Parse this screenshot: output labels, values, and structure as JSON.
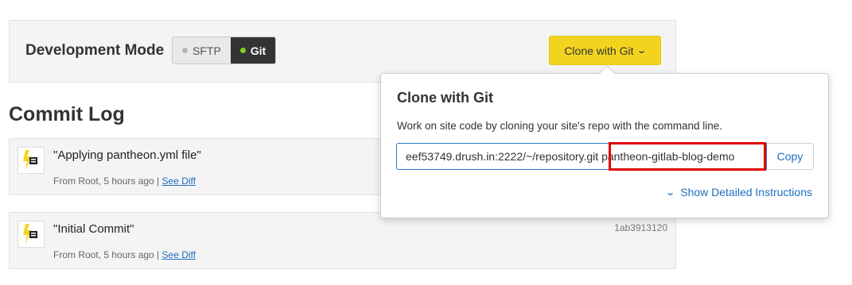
{
  "dev_mode": {
    "title": "Development Mode",
    "options": [
      {
        "label": "SFTP",
        "selected": false
      },
      {
        "label": "Git",
        "selected": true
      }
    ],
    "clone_button_label": "Clone with Git"
  },
  "commit_log": {
    "title": "Commit Log",
    "commits": [
      {
        "message": "\"Applying pantheon.yml file\"",
        "meta": "From Root, 5 hours ago |",
        "diff_label": "See Diff",
        "hash": ""
      },
      {
        "message": "\"Initial Commit\"",
        "meta": "From Root, 5 hours ago |",
        "diff_label": "See Diff",
        "hash": "1ab3913120"
      }
    ]
  },
  "clone_popover": {
    "title": "Clone with Git",
    "description": "Work on site code by cloning your site's repo with the command line.",
    "command": "eef53749.drush.in:2222/~/repository.git pantheon-gitlab-blog-demo",
    "copy_label": "Copy",
    "details_label": "Show Detailed Instructions"
  },
  "colors": {
    "accent_yellow": "#f2d41f",
    "link_blue": "#1e6fbf",
    "highlight_red": "#e00000",
    "status_green": "#7ccf1e"
  }
}
